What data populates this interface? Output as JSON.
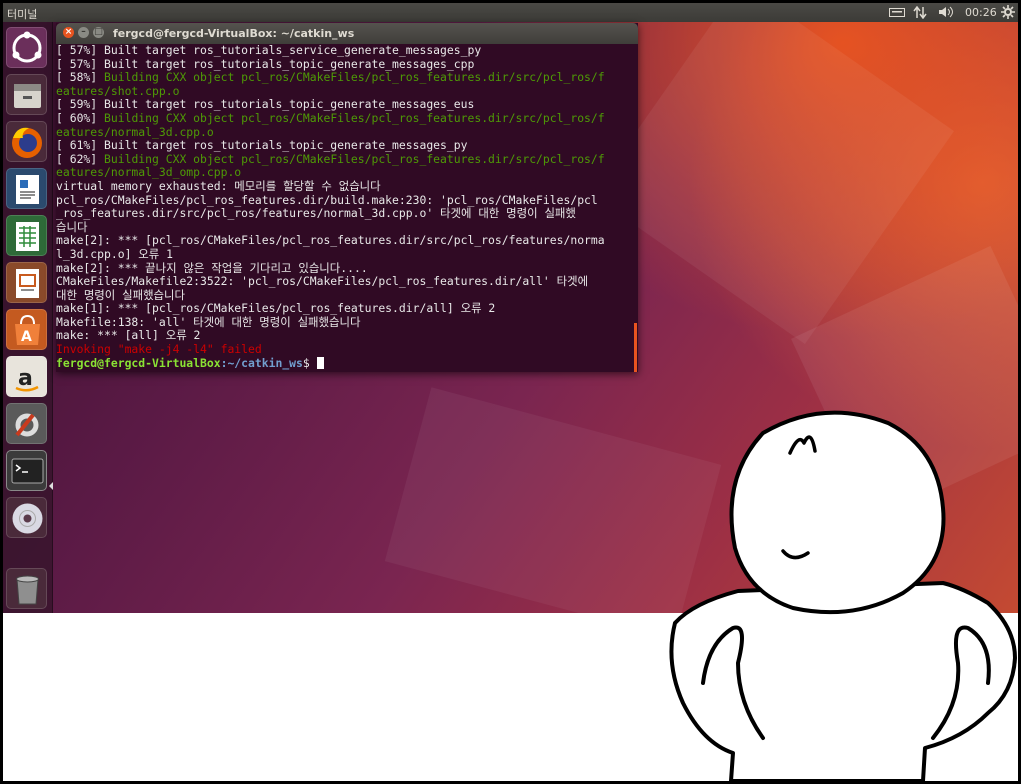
{
  "topbar": {
    "app_name": "터미널",
    "clock": "00:26",
    "indicators": [
      "keyboard-icon",
      "network-icon",
      "volume-icon",
      "settings-icon"
    ]
  },
  "launcher": {
    "items": [
      {
        "name": "ubuntu-dash",
        "icon": "ubuntu-logo-icon"
      },
      {
        "name": "files",
        "icon": "files-icon"
      },
      {
        "name": "firefox",
        "icon": "firefox-icon"
      },
      {
        "name": "libreoffice-writer",
        "icon": "writer-icon"
      },
      {
        "name": "libreoffice-calc",
        "icon": "calc-icon"
      },
      {
        "name": "libreoffice-impress",
        "icon": "impress-icon"
      },
      {
        "name": "ubuntu-software",
        "icon": "software-center-icon"
      },
      {
        "name": "amazon",
        "icon": "amazon-icon"
      },
      {
        "name": "system-settings",
        "icon": "settings-icon"
      },
      {
        "name": "terminal",
        "icon": "terminal-icon",
        "active": true
      },
      {
        "name": "dvd",
        "icon": "disc-icon"
      },
      {
        "name": "trash",
        "icon": "trash-icon"
      }
    ]
  },
  "terminal": {
    "title": "fergcd@fergcd-VirtualBox: ~/catkin_ws",
    "lines": [
      {
        "text": "[ 57%] Built target ros_tutorials_service_generate_messages_py",
        "style": ""
      },
      {
        "text": "[ 57%] Built target ros_tutorials_topic_generate_messages_cpp",
        "style": ""
      },
      {
        "pre": "[ 58%] ",
        "text": "Building CXX object pcl_ros/CMakeFiles/pcl_ros_features.dir/src/pcl_ros/f",
        "style": "g"
      },
      {
        "text": "eatures/shot.cpp.o",
        "style": "g"
      },
      {
        "text": "[ 59%] Built target ros_tutorials_topic_generate_messages_eus",
        "style": ""
      },
      {
        "pre": "[ 60%] ",
        "text": "Building CXX object pcl_ros/CMakeFiles/pcl_ros_features.dir/src/pcl_ros/f",
        "style": "g"
      },
      {
        "text": "eatures/normal_3d.cpp.o",
        "style": "g"
      },
      {
        "text": "[ 61%] Built target ros_tutorials_topic_generate_messages_py",
        "style": ""
      },
      {
        "pre": "[ 62%] ",
        "text": "Building CXX object pcl_ros/CMakeFiles/pcl_ros_features.dir/src/pcl_ros/f",
        "style": "g"
      },
      {
        "text": "eatures/normal_3d_omp.cpp.o",
        "style": "g"
      },
      {
        "text": "virtual memory exhausted: 메모리를 할당할 수 없습니다",
        "style": ""
      },
      {
        "text": "pcl_ros/CMakeFiles/pcl_ros_features.dir/build.make:230: 'pcl_ros/CMakeFiles/pcl",
        "style": ""
      },
      {
        "text": "_ros_features.dir/src/pcl_ros/features/normal_3d.cpp.o' 타겟에 대한 명령이 실패했",
        "style": ""
      },
      {
        "text": "습니다",
        "style": ""
      },
      {
        "text": "make[2]: *** [pcl_ros/CMakeFiles/pcl_ros_features.dir/src/pcl_ros/features/norma",
        "style": ""
      },
      {
        "text": "l_3d.cpp.o] 오류 1",
        "style": ""
      },
      {
        "text": "make[2]: *** 끝나지 않은 작업을 기다리고 있습니다....",
        "style": ""
      },
      {
        "text": "CMakeFiles/Makefile2:3522: 'pcl_ros/CMakeFiles/pcl_ros_features.dir/all' 타겟에",
        "style": ""
      },
      {
        "text": "대한 명령이 실패했습니다",
        "style": ""
      },
      {
        "text": "make[1]: *** [pcl_ros/CMakeFiles/pcl_ros_features.dir/all] 오류 2",
        "style": ""
      },
      {
        "text": "Makefile:138: 'all' 타겟에 대한 명령이 실패했습니다",
        "style": ""
      },
      {
        "text": "make: *** [all] 오류 2",
        "style": ""
      },
      {
        "text": "Invoking \"make -j4 -l4\" failed",
        "style": "r"
      }
    ],
    "prompt_user": "fergcd@fergcd-VirtualBox",
    "prompt_path": ":~/catkin_ws",
    "prompt_symbol": "$ "
  },
  "colors": {
    "terminal_bg": "#300a24",
    "build_green": "#4e9a06",
    "error_red": "#cc0000",
    "ubuntu_orange": "#e95420"
  }
}
